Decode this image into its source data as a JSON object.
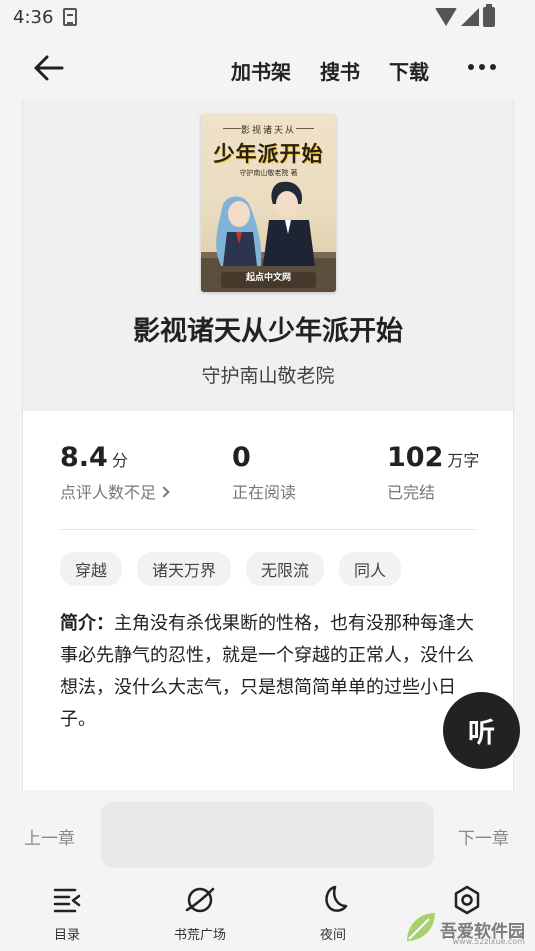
{
  "status_bar": {
    "time": "4:36"
  },
  "nav": {
    "add_shelf": "加书架",
    "search": "搜书",
    "download": "下载"
  },
  "book": {
    "cover": {
      "subtitle": "影视诸天从",
      "title": "少年派开始",
      "author": "守护南山敬老院 著",
      "publisher": "起点中文网"
    },
    "title": "影视诸天从少年派开始",
    "author": "守护南山敬老院"
  },
  "stats": [
    {
      "value": "8.4",
      "unit": "分",
      "label": "点评人数不足"
    },
    {
      "value": "0",
      "unit": "",
      "label": "正在阅读"
    },
    {
      "value": "102",
      "unit": "万字",
      "label": "已完结"
    }
  ],
  "tags": [
    "穿越",
    "诸天万界",
    "无限流",
    "同人"
  ],
  "intro": {
    "label": "简介：",
    "text": "主角没有杀伐果断的性格，也有没那种每逢大事必先静气的忍性，就是一个穿越的正常人，没什么想法，没什么大志气，只是想简简单单的过些小日子。"
  },
  "listen_label": "听",
  "chapter_nav": {
    "prev": "上一章",
    "next": "下一章"
  },
  "tabbar": [
    {
      "label": "目录",
      "icon": "list-icon"
    },
    {
      "label": "书荒广场",
      "icon": "planet-icon"
    },
    {
      "label": "夜间",
      "icon": "moon-icon"
    },
    {
      "label": "设置",
      "icon": "settings-icon"
    }
  ],
  "watermark": {
    "text": "吾爱软件园",
    "url": "www.52zixue.com"
  }
}
